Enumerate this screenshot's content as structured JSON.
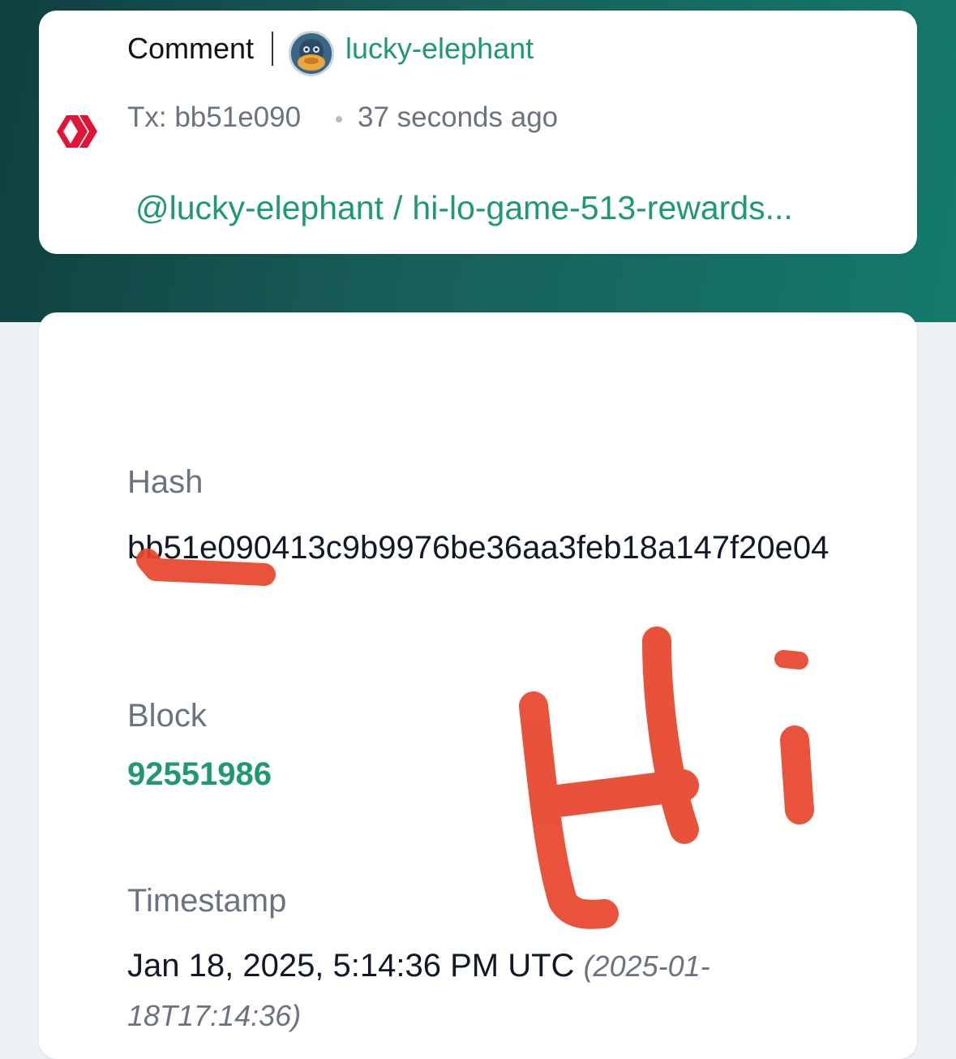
{
  "operation": {
    "type_label": "Comment",
    "author": "lucky-elephant",
    "tx_label": "Tx: bb51e090",
    "time_ago": "37 seconds ago",
    "permlink_author": "@lucky-elephant",
    "permlink_separator": "/",
    "permlink": "hi-lo-game-513-rewards..."
  },
  "details": {
    "hash_label": "Hash",
    "hash_value": "bb51e090413c9b9976be36aa3feb18a147f20e04",
    "block_label": "Block",
    "block_value": "92551986",
    "timestamp_label": "Timestamp",
    "timestamp_value": "Jan 18, 2025, 5:14:36 PM UTC",
    "timestamp_iso": "(2025-01-18T17:14:36)"
  },
  "icons": {
    "chain_logo": "hive-logo-icon",
    "avatar": "user-avatar"
  },
  "colors": {
    "accent_green": "#1e9a6e",
    "header_teal": "#185f59",
    "chain_red": "#e31337",
    "annotation_red": "#e8442a"
  }
}
